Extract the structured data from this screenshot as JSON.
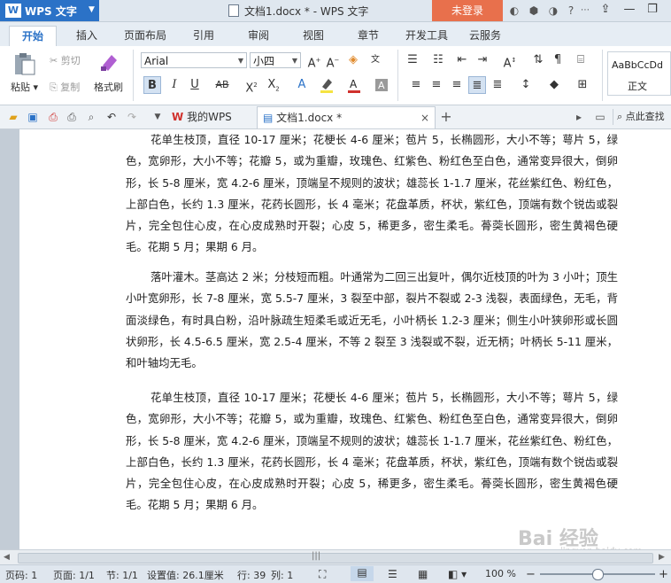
{
  "app": {
    "name": "WPS 文字",
    "doc_title": "文档1.docx * - WPS 文字",
    "login": "未登录"
  },
  "tabs": [
    "开始",
    "插入",
    "页面布局",
    "引用",
    "审阅",
    "视图",
    "章节",
    "开发工具",
    "云服务"
  ],
  "active_tab": "开始",
  "ribbon": {
    "paste": "粘贴",
    "cut": "剪切",
    "copy": "复制",
    "format_painter": "格式刷",
    "font_name": "Arial",
    "font_size": "小四",
    "style_preview": "AaBbCcDd",
    "style_name": "正文"
  },
  "quick": {
    "doc_tabs": [
      {
        "label": "我的WPS"
      },
      {
        "label": "文档1.docx *"
      }
    ],
    "search": "点此查找"
  },
  "document": {
    "paragraphs": [
      "花单生枝顶，直径 10-17 厘米；花梗长 4-6 厘米；苞片 5，长椭圆形，大小不等；萼片 5，绿色，宽卵形，大小不等；花瓣 5，或为重瓣，玫瑰色、红紫色、粉红色至白色，通常变异很大，倒卵形，长 5-8 厘米，宽 4.2-6 厘米，顶端呈不规则的波状；雄蕊长 1-1.7 厘米，花丝紫红色、粉红色，上部白色，长约 1.3 厘米，花药长圆形，长 4 毫米；花盘革质，杯状，紫红色，顶端有数个锐齿或裂片，完全包住心皮，在心皮成熟时开裂；心皮 5，稀更多，密生柔毛。蓇葖长圆形，密生黄褐色硬毛。花期 5 月；果期 6 月。",
      "落叶灌木。茎高达 2 米；分枝短而粗。叶通常为二回三出复叶，偶尔近枝顶的叶为 3 小叶；顶生小叶宽卵形，长 7-8 厘米，宽 5.5-7 厘米，3 裂至中部，裂片不裂或 2-3 浅裂，表面绿色，无毛，背面淡绿色，有时具白粉，沿叶脉疏生短柔毛或近无毛，小叶柄长 1.2-3 厘米；侧生小叶狭卵形或长圆状卵形，长 4.5-6.5 厘米，宽 2.5-4 厘米，不等 2 裂至 3 浅裂或不裂，近无柄；叶柄长 5-11 厘米，和叶轴均无毛。",
      "花单生枝顶，直径 10-17 厘米；花梗长 4-6 厘米；苞片 5，长椭圆形，大小不等；萼片 5，绿色，宽卵形，大小不等；花瓣 5，或为重瓣，玫瑰色、红紫色、粉红色至白色，通常变异很大，倒卵形，长 5-8 厘米，宽 4.2-6 厘米，顶端呈不规则的波状；雄蕊长 1-1.7 厘米，花丝紫红色、粉红色，上部白色，长约 1.3 厘米，花药长圆形，长 4 毫米；花盘革质，杯状，紫红色，顶端有数个锐齿或裂片，完全包住心皮，在心皮成熟时开裂；心皮 5，稀更多，密生柔毛。蓇葖长圆形，密生黄褐色硬毛。花期 5 月；果期 6 月。"
    ]
  },
  "status": {
    "page_no": "页码: 1",
    "pages": "页面: 1/1",
    "section": "节: 1/1",
    "setting": "设置值: 26.1厘米",
    "line": "行: 39",
    "col": "列: 1",
    "zoom": "100 %"
  },
  "watermark": {
    "brand": "Bai 经验",
    "url": "jingyan.baidu.com"
  },
  "colors": {
    "accent": "#2b72c7",
    "login": "#e8704c",
    "wps_red": "#d0312d"
  }
}
